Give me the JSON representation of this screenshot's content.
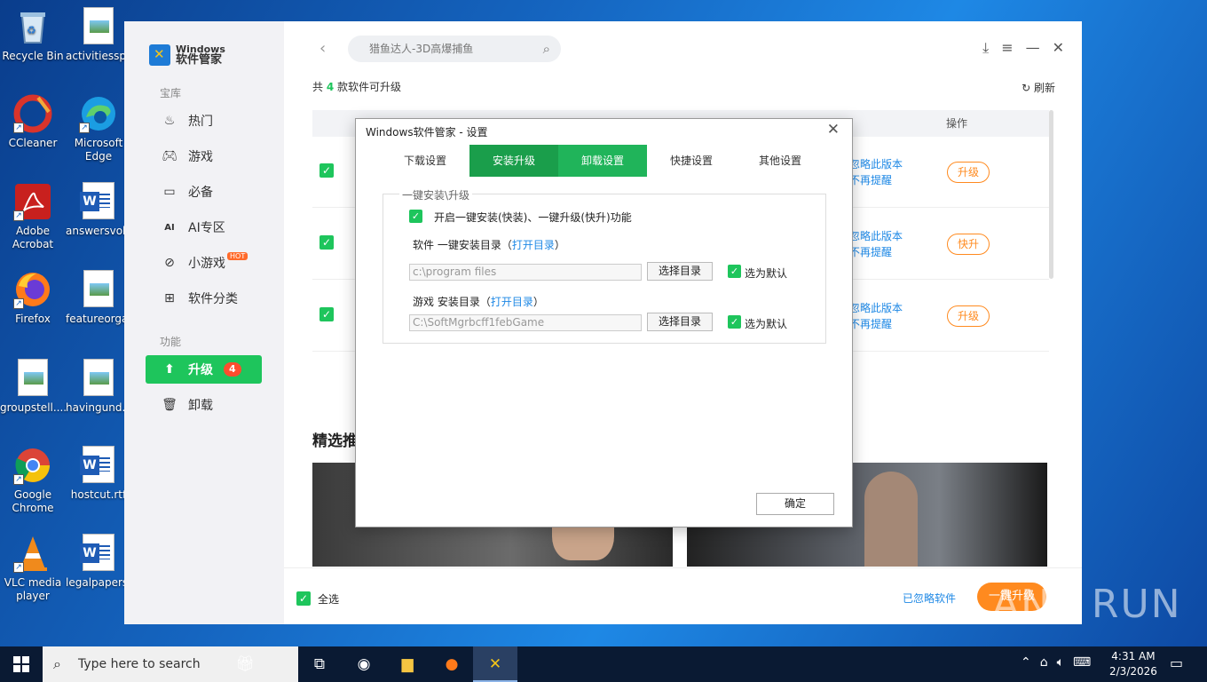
{
  "desktop": {
    "icons": [
      {
        "label": "Recycle Bin"
      },
      {
        "label": "activitiessp..."
      },
      {
        "label": "CCleaner"
      },
      {
        "label": "Microsoft Edge"
      },
      {
        "label": "Adobe Acrobat"
      },
      {
        "label": "answersvol..."
      },
      {
        "label": "Firefox"
      },
      {
        "label": "featureorga..."
      },
      {
        "label": "groupstell...."
      },
      {
        "label": "havingund..."
      },
      {
        "label": "Google Chrome"
      },
      {
        "label": "hostcut.rtf"
      },
      {
        "label": "VLC media player"
      },
      {
        "label": "legalpapers..."
      }
    ]
  },
  "app": {
    "logo": {
      "line1": "Windows",
      "line2": "软件管家"
    },
    "sidebar": {
      "section_library": "宝库",
      "items": [
        {
          "label": "热门",
          "icon": "fire-icon"
        },
        {
          "label": "游戏",
          "icon": "gamepad-icon"
        },
        {
          "label": "必备",
          "icon": "monitor-icon"
        },
        {
          "label": "AI专区",
          "icon": "ai-icon"
        },
        {
          "label": "小游戏",
          "icon": "minigame-icon",
          "tag": "HOT"
        },
        {
          "label": "软件分类",
          "icon": "grid-icon"
        }
      ],
      "section_function": "功能",
      "upgrade": {
        "label": "升级",
        "badge": "4"
      },
      "uninstall": {
        "label": "卸载"
      }
    },
    "search": {
      "placeholder": "猎鱼达人-3D高爆捕鱼"
    },
    "count_prefix": "共",
    "count_value": "4",
    "count_suffix": "款软件可升级",
    "refresh_label": "刷新",
    "table": {
      "col_operation": "操作",
      "rows": [
        {
          "ignore_line1": "忽略此版本",
          "ignore_line2": "不再提醒",
          "action": "升级"
        },
        {
          "ignore_line1": "忽略此版本",
          "ignore_line2": "不再提醒",
          "action": "快升"
        },
        {
          "ignore_line1": "忽略此版本",
          "ignore_line2": "不再提醒",
          "action": "升级"
        }
      ]
    },
    "featured_title": "精选推",
    "footer": {
      "select_all": "全选",
      "ignored_software": "已忽略软件",
      "one_click_upgrade": "一键升级"
    }
  },
  "dialog": {
    "title": "Windows软件管家 - 设置",
    "tabs": [
      "下载设置",
      "安装升级",
      "卸载设置",
      "快捷设置",
      "其他设置"
    ],
    "group_title": "一键安装\\升级",
    "enable_option": "开启一键安装(快装)、一键升级(快升)功能",
    "software_dir_label": "软件 一键安装目录（",
    "open_dir": "打开目录",
    "close_paren": "）",
    "software_path": "c:\\program files",
    "choose_dir": "选择目录",
    "set_default": "选为默认",
    "game_dir_label": "游戏 安装目录（",
    "game_path": "C:\\SoftMgrbcff1febGame",
    "ok": "确定"
  },
  "watermark": "ANY RUN",
  "taskbar": {
    "search_placeholder": "Type here to search",
    "time": "4:31 AM",
    "date": "2/3/2026"
  }
}
